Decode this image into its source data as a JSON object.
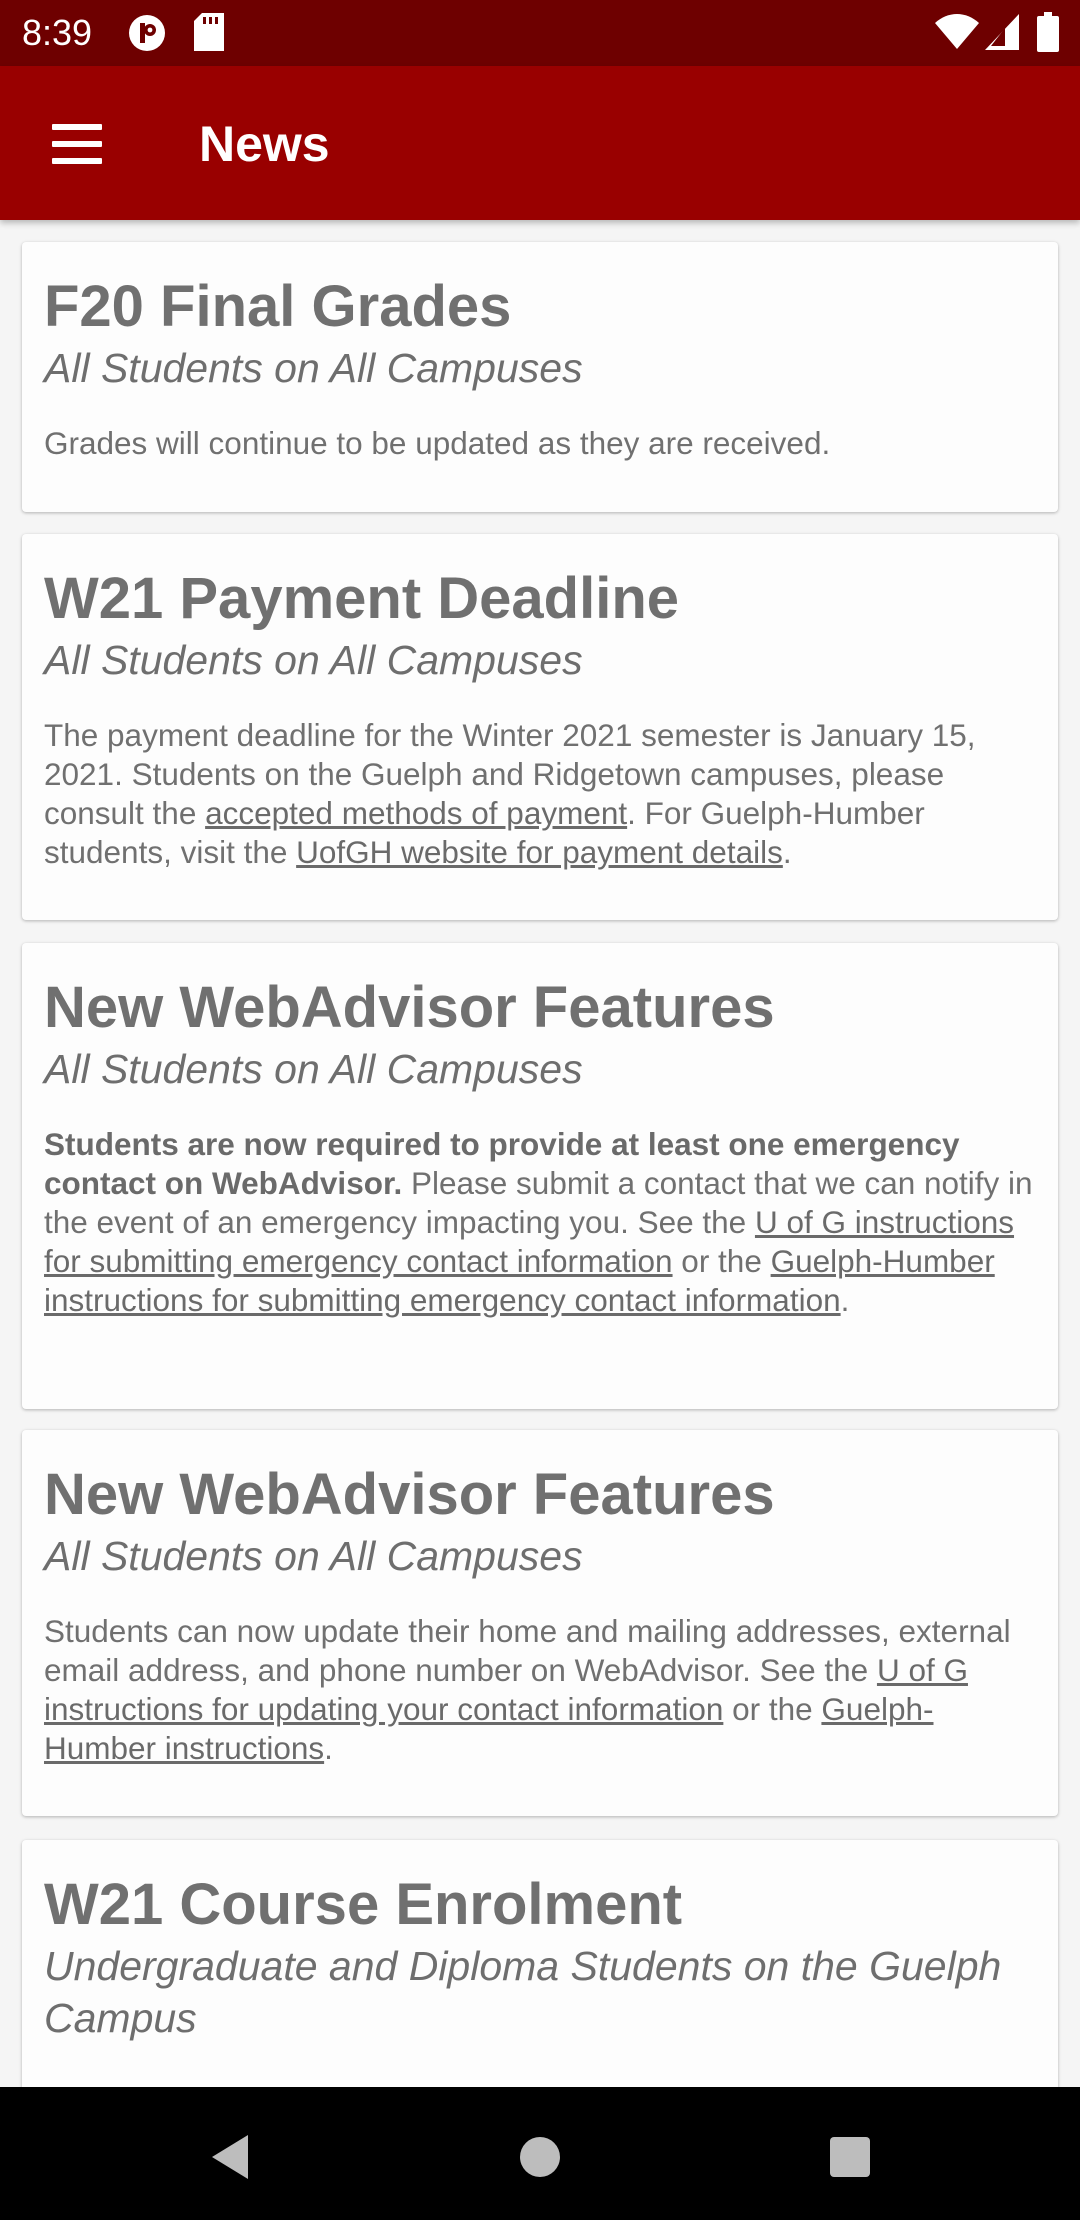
{
  "status": {
    "time": "8:39",
    "icons": [
      "notification-icon",
      "sd-card-icon",
      "wifi-icon",
      "signal-icon",
      "battery-icon"
    ]
  },
  "appbar": {
    "title": "News",
    "menu_icon": "hamburger-menu-icon",
    "background": "#990000"
  },
  "cards": [
    {
      "title": "F20 Final Grades",
      "audience": "All Students on All Campuses",
      "body": [
        "Grades will continue to be updated as they are received."
      ]
    },
    {
      "title": "W21 Payment Deadline",
      "audience": "All Students on All Campuses",
      "body": [
        "The payment deadline for the Winter 2021 semester is January 15, 2021. Students on the Guelph and Ridgetown campuses, please consult the ",
        "accepted methods of payment",
        ". For Guelph-Humber students, visit the ",
        "UofGH website for payment details",
        "."
      ]
    },
    {
      "title": "New WebAdvisor Features",
      "audience": "All Students on All Campuses",
      "body": [
        "Students are now required to provide at least one emergency contact on WebAdvisor.",
        " Please submit a contact that we can notify in the event of an emergency impacting you. See the ",
        "U of G instructions for submitting emergency contact information",
        " or the ",
        "Guelph-Humber instructions for submitting emergency contact information",
        "."
      ]
    },
    {
      "title": "New WebAdvisor Features",
      "audience": "All Students on All Campuses",
      "body": [
        "Students can now update their home and mailing addresses, external email address, and phone number on WebAdvisor. See the ",
        "U of G instructions for updating your contact information",
        " or the ",
        "Guelph-Humber instructions",
        "."
      ]
    },
    {
      "title": "W21 Course Enrolment",
      "audience": "Undergraduate and Diploma Students on the Guelph Campus",
      "body": []
    }
  ],
  "navbar": {
    "icons": [
      "back-icon",
      "home-icon",
      "recents-icon"
    ]
  }
}
